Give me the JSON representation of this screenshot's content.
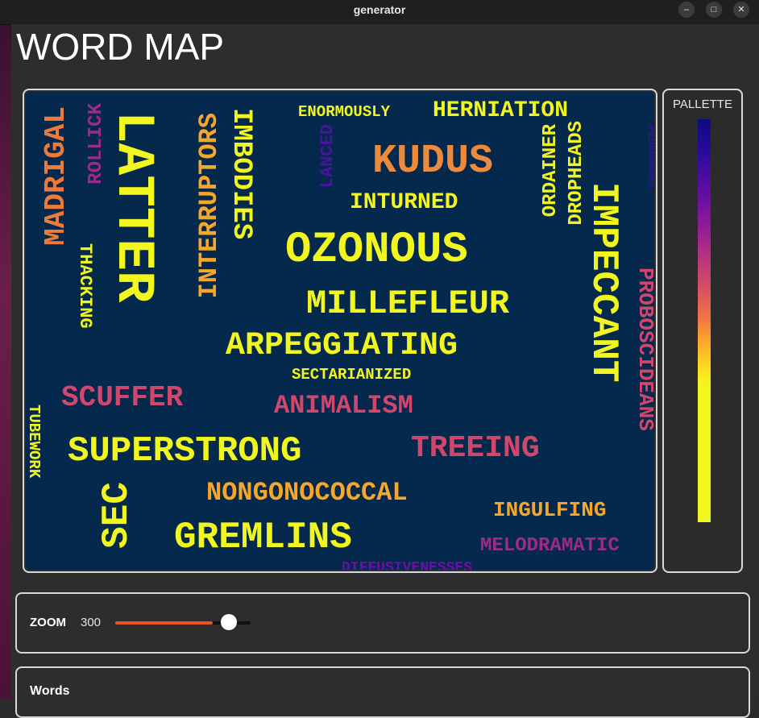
{
  "window": {
    "title": "generator",
    "minimize_glyph": "–",
    "maximize_glyph": "□",
    "close_glyph": "✕"
  },
  "app": {
    "title": "WORD MAP"
  },
  "palette": {
    "title": "PALLETTE",
    "colors": [
      "#0c0a85",
      "#6a0fa3",
      "#d0476b",
      "#fca52d",
      "#f2f61f"
    ]
  },
  "word_map": {
    "background": "#05294d",
    "words": [
      {
        "text": "MADRIGAL",
        "color": "#ee7a3a"
      },
      {
        "text": "ROLLICK",
        "color": "#9c2a8a"
      },
      {
        "text": "THACKING",
        "color": "#f2f61f"
      },
      {
        "text": "LATTER",
        "color": "#f2f61f"
      },
      {
        "text": "INTERRUPTORS",
        "color": "#f6a72a"
      },
      {
        "text": "IMBODIES",
        "color": "#f2f61f"
      },
      {
        "text": "ENORMOUSLY",
        "color": "#f2f61f"
      },
      {
        "text": "HERNIATION",
        "color": "#f2f61f"
      },
      {
        "text": "LANCED",
        "color": "#4a12a0"
      },
      {
        "text": "KUDUS",
        "color": "#ee8a3c"
      },
      {
        "text": "INTURNED",
        "color": "#f2f61f"
      },
      {
        "text": "ORDAINER",
        "color": "#f2f61f"
      },
      {
        "text": "DROPHEADS",
        "color": "#f2f61f"
      },
      {
        "text": "IMPECCANT",
        "color": "#f2f61f"
      },
      {
        "text": "PEDAGOGUES",
        "color": "#3a0ea0"
      },
      {
        "text": "OZONOUS",
        "color": "#f2f61f"
      },
      {
        "text": "MILLEFLEUR",
        "color": "#f2f61f"
      },
      {
        "text": "PROBOSCIDEANS",
        "color": "#d0476b"
      },
      {
        "text": "ARPEGGIATING",
        "color": "#f2f61f"
      },
      {
        "text": "SECTARIANIZED",
        "color": "#f2f61f"
      },
      {
        "text": "SCUFFER",
        "color": "#d0476b"
      },
      {
        "text": "ANIMALISM",
        "color": "#d0476b"
      },
      {
        "text": "TUBEWORK",
        "color": "#f2f61f"
      },
      {
        "text": "SUPERSTRONG",
        "color": "#f2f61f"
      },
      {
        "text": "TREEING",
        "color": "#d0476b"
      },
      {
        "text": "SEC",
        "color": "#f2f61f"
      },
      {
        "text": "NONGONOCOCCAL",
        "color": "#f6a72a"
      },
      {
        "text": "INGULFING",
        "color": "#f6a72a"
      },
      {
        "text": "GREMLINS",
        "color": "#f2f61f"
      },
      {
        "text": "MELODRAMATIC",
        "color": "#9c2a8a"
      },
      {
        "text": "DIFFUSIVENESSES",
        "color": "#6a0fa3"
      }
    ]
  },
  "zoom": {
    "label": "ZOOM",
    "value": "300",
    "level": 0.72,
    "accent": "#e95420"
  },
  "words_section": {
    "label": "Words"
  }
}
